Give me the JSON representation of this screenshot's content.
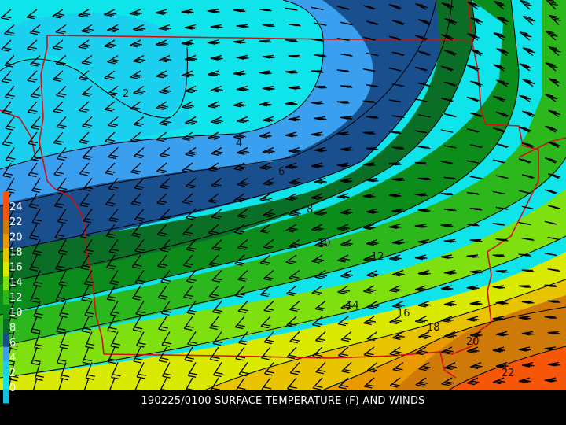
{
  "caption": "190225/0100 SURFACE TEMPERATURE (F) AND WINDS",
  "legend": {
    "labels": [
      "0",
      "2",
      "4",
      "6",
      "8",
      "10",
      "12",
      "14",
      "16",
      "18",
      "20",
      "22",
      "24"
    ],
    "colors": [
      "#15bfdd",
      "#0ee4ea",
      "#1ad0ee",
      "#3a9fee",
      "#1a4f8e",
      "#0a6e27",
      "#0b8c1b",
      "#2cb81c",
      "#7fe010",
      "#d9e900",
      "#e7c300",
      "#e89a00",
      "#cd7a09",
      "#f55608",
      "#ff5005"
    ]
  },
  "contour_labels": [
    {
      "text": "2"
    },
    {
      "text": "4"
    },
    {
      "text": "6"
    },
    {
      "text": "8"
    },
    {
      "text": "10"
    },
    {
      "text": "12"
    },
    {
      "text": "14"
    },
    {
      "text": "16"
    },
    {
      "text": "18"
    },
    {
      "text": "20"
    },
    {
      "text": "22"
    }
  ],
  "colors": {
    "border": "#d11010",
    "contour": "#000000",
    "barb": "#000000",
    "background": "#000000"
  }
}
